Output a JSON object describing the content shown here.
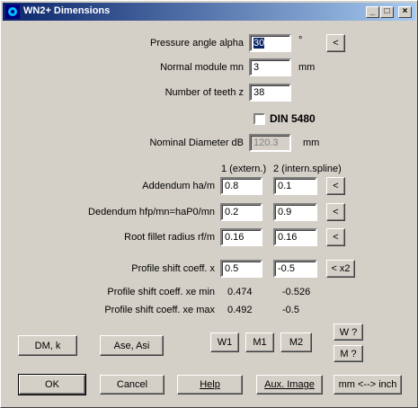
{
  "window": {
    "title": "WN2+  Dimensions",
    "minimize": "_",
    "maximize": "□",
    "close": "×"
  },
  "pressure_angle": {
    "label": "Pressure angle alpha",
    "value": "30",
    "unit": "°",
    "btn": "<"
  },
  "normal_module": {
    "label": "Normal module mn",
    "value": "3",
    "unit": "mm"
  },
  "num_teeth": {
    "label": "Number of teeth z",
    "value": "38"
  },
  "din": {
    "label": "DIN 5480",
    "checked": false
  },
  "nominal_diameter": {
    "label": "Nominal Diameter dB",
    "value": "120.3",
    "unit": "mm"
  },
  "columns": {
    "col1": "1 (extern.)",
    "col2": "2 (intern.spline)"
  },
  "addendum": {
    "label": "Addendum ha/m",
    "v1": "0.8",
    "v2": "0.1",
    "btn": "<"
  },
  "dedendum": {
    "label": "Dedendum hfp/mn=haP0/mn",
    "v1": "0.2",
    "v2": "0.9",
    "btn": "<"
  },
  "root_fillet": {
    "label": "Root fillet radius rf/m",
    "v1": "0.16",
    "v2": "0.16",
    "btn": "<"
  },
  "profile_shift": {
    "label": "Profile shift coeff. x",
    "v1": "0.5",
    "v2": "-0.5",
    "btn": "< x2"
  },
  "xe_min": {
    "label": "Profile shift coeff. xe min",
    "v1": "0.474",
    "v2": "-0.526"
  },
  "xe_max": {
    "label": "Profile shift coeff. xe max",
    "v1": "0.492",
    "v2": "-0.5"
  },
  "buttons": {
    "dm_k": "DM, k",
    "ase_asi": "Ase, Asi",
    "w1": "W1",
    "m1": "M1",
    "m2": "M2",
    "w_help": "W ?",
    "m_help": "M ?",
    "ok": "OK",
    "cancel": "Cancel",
    "help": "Help",
    "aux_image": "Aux. Image",
    "units": "mm <--> inch"
  }
}
